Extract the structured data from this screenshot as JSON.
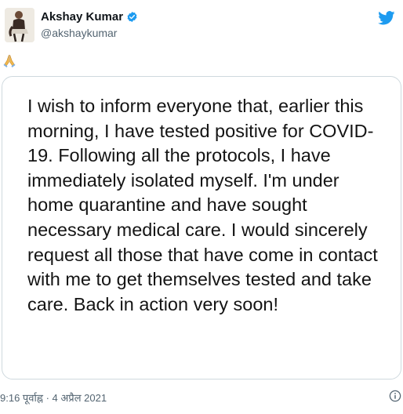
{
  "tweet": {
    "author": {
      "display_name": "Akshay Kumar",
      "handle": "@akshaykumar",
      "verified": true,
      "avatar_icon": "profile-photo"
    },
    "emoji": "🙏",
    "statement_text": "I wish to inform everyone that, earlier this morning, I have tested positive for COVID-19. Following all the protocols, I have immediately isolated myself. I'm under home quarantine and have sought necessary medical care. I would sincerely request all those that have come in contact with me to get themselves tested and take care. Back in action very soon!",
    "timestamp": "9:16 पूर्वाह्न · 4 अप्रैल 2021"
  },
  "icons": {
    "brand": "twitter-bird-icon",
    "verified": "verified-badge-icon",
    "info": "info-icon"
  },
  "colors": {
    "brand_blue": "#1d9bf0",
    "text": "#0f1419",
    "muted": "#536471",
    "border": "#cfd9de"
  }
}
